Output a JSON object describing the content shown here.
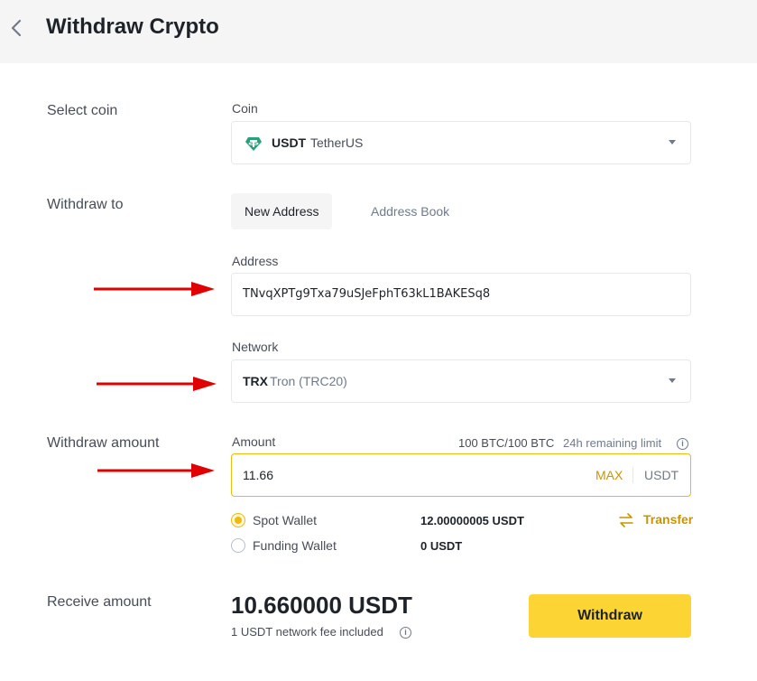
{
  "header": {
    "title": "Withdraw Crypto"
  },
  "sections": {
    "select_coin": "Select coin",
    "withdraw_to": "Withdraw to",
    "withdraw_amount": "Withdraw amount",
    "receive_amount": "Receive amount"
  },
  "coin": {
    "label": "Coin",
    "symbol": "USDT",
    "name": "TetherUS",
    "icon": "tether-icon",
    "icon_color": "#26a17b"
  },
  "tabs": [
    {
      "label": "New Address"
    },
    {
      "label": "Address Book"
    }
  ],
  "address": {
    "label": "Address",
    "value": "TNvqXPTg9Txa79uSJeFphT63kL1BAKESq8"
  },
  "network": {
    "label": "Network",
    "symbol": "TRX",
    "name": "Tron (TRC20)"
  },
  "amount": {
    "label": "Amount",
    "limit_value": "100 BTC/100 BTC",
    "limit_text": "24h remaining limit",
    "value": "11.66",
    "max_label": "MAX",
    "unit": "USDT"
  },
  "wallets": [
    {
      "name": "Spot Wallet",
      "balance": "12.00000005 USDT",
      "selected": true
    },
    {
      "name": "Funding Wallet",
      "balance": "0 USDT",
      "selected": false
    }
  ],
  "transfer": {
    "label": "Transfer"
  },
  "receive": {
    "value": "10.660000 USDT",
    "fee_note": "1 USDT network fee included"
  },
  "withdraw_button": {
    "label": "Withdraw"
  },
  "colors": {
    "accent": "#f0b90b",
    "button": "#fcd535",
    "arrow": "#e00000",
    "link": "#c99400"
  }
}
